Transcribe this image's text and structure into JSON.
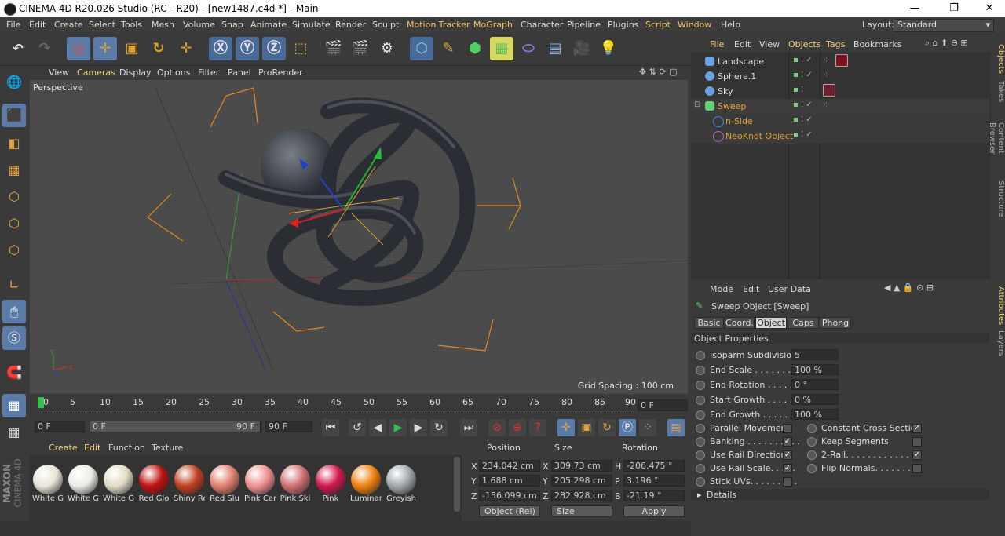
{
  "window": {
    "title": "CINEMA 4D R20.026 Studio (RC - R20) - [new1487.c4d *] - Main",
    "min": "—",
    "max": "❐",
    "close": "✕"
  },
  "menu": [
    "File",
    "Edit",
    "Create",
    "Select",
    "Tools",
    "Mesh",
    "Volume",
    "Snap",
    "Animate",
    "Simulate",
    "Render",
    "Sculpt",
    "Motion Tracker",
    "MoGraph",
    "Character",
    "Pipeline",
    "Plugins",
    "Script",
    "Window",
    "Help"
  ],
  "layout": {
    "label": "Layout:",
    "value": "Standard"
  },
  "viewport": {
    "menu": [
      "View",
      "Cameras",
      "Display",
      "Options",
      "Filter",
      "Panel",
      "ProRender"
    ],
    "label": "Perspective",
    "grid_spacing": "Grid Spacing : 100 cm"
  },
  "timeline": {
    "ticks": [
      "0",
      "5",
      "10",
      "15",
      "20",
      "25",
      "30",
      "35",
      "40",
      "45",
      "50",
      "55",
      "60",
      "65",
      "70",
      "75",
      "80",
      "85",
      "90"
    ],
    "current": "0 F",
    "start": "0 F",
    "range_start": "0 F",
    "range_end": "90 F",
    "end": "90 F"
  },
  "materials": {
    "menu": [
      "Create",
      "Edit",
      "Function",
      "Texture"
    ],
    "items": [
      {
        "name": "White G",
        "color": "#e8e4d8"
      },
      {
        "name": "White G",
        "color": "#ecebe6"
      },
      {
        "name": "White G",
        "color": "#e2dcc4"
      },
      {
        "name": "Red Glo",
        "color": "#c01010"
      },
      {
        "name": "Shiny Re",
        "color": "#c04020"
      },
      {
        "name": "Red Slu",
        "color": "#e08070"
      },
      {
        "name": "Pink Car",
        "color": "#f09090"
      },
      {
        "name": "Pink Ski",
        "color": "#d07070"
      },
      {
        "name": "Pink",
        "color": "#d0184a"
      },
      {
        "name": "Luminar",
        "color": "#f08010"
      },
      {
        "name": "Greyish",
        "color": "#a0a8ac"
      }
    ]
  },
  "coords": {
    "headers": [
      "Position",
      "Size",
      "Rotation"
    ],
    "rows": [
      {
        "axis": "X",
        "pos": "234.042 cm",
        "size_axis": "X",
        "size": "309.73 cm",
        "rot_axis": "H",
        "rot": "-206.475 °"
      },
      {
        "axis": "Y",
        "pos": "1.688 cm",
        "size_axis": "Y",
        "size": "205.298 cm",
        "rot_axis": "P",
        "rot": "3.196 °"
      },
      {
        "axis": "Z",
        "pos": "-156.099 cm",
        "size_axis": "Z",
        "size": "282.928 cm",
        "rot_axis": "B",
        "rot": "-21.19 °"
      }
    ],
    "mode": "Object (Rel)",
    "size_mode": "Size",
    "apply": "Apply"
  },
  "objects": {
    "menu": [
      "File",
      "Edit",
      "View",
      "Objects",
      "Tags",
      "Bookmarks"
    ],
    "items": [
      {
        "name": "Landscape",
        "color": "#6aa0e0",
        "child": false
      },
      {
        "name": "Sphere.1",
        "color": "#6aa0e0",
        "child": false
      },
      {
        "name": "Sky",
        "color": "#6aa0e0",
        "child": false
      },
      {
        "name": "Sweep",
        "color": "#60d070",
        "child": false,
        "highlight": true
      },
      {
        "name": "n-Side",
        "color": "#5080e0",
        "child": true
      },
      {
        "name": "NeoKnot Object",
        "color": "#b060c0",
        "child": true
      }
    ]
  },
  "attributes": {
    "menu": [
      "Mode",
      "Edit",
      "User Data"
    ],
    "object_title": "Sweep Object [Sweep]",
    "tabs": [
      "Basic",
      "Coord.",
      "Object",
      "Caps",
      "Phong"
    ],
    "selected_tab": "Object",
    "section": "Object Properties",
    "props": [
      {
        "label": "Isoparm Subdivision",
        "value": "5"
      },
      {
        "label": "End Scale . . . . . . . . .",
        "value": "100 %"
      },
      {
        "label": "End Rotation . . . . . .",
        "value": "0 °"
      },
      {
        "label": "Start Growth . . . . . .",
        "value": "0 %"
      },
      {
        "label": "End Growth . . . . . . .",
        "value": "100 %"
      }
    ],
    "checks_left": [
      {
        "label": "Parallel Movement",
        "checked": false
      },
      {
        "label": "Banking . . . . . . . . . .",
        "checked": true
      },
      {
        "label": "Use Rail Direction",
        "checked": true
      },
      {
        "label": "Use Rail Scale. . . . .",
        "checked": true
      },
      {
        "label": "Stick UVs. . . . . . . . .",
        "checked": false
      }
    ],
    "checks_right": [
      {
        "label": "Constant Cross Section",
        "checked": true
      },
      {
        "label": "Keep Segments",
        "checked": false
      },
      {
        "label": "2-Rail. . . . . . . . . . . . . .",
        "checked": true
      },
      {
        "label": "Flip Normals. . . . . . . .",
        "checked": false
      }
    ],
    "details": "Details"
  },
  "side_tabs_top": [
    "Objects",
    "Takes",
    "Content Browser",
    "Structure"
  ],
  "side_tabs_bottom": [
    "Attributes",
    "Layers"
  ],
  "brand": {
    "maxon": "MAXON",
    "c4d": "CINEMA 4D"
  }
}
